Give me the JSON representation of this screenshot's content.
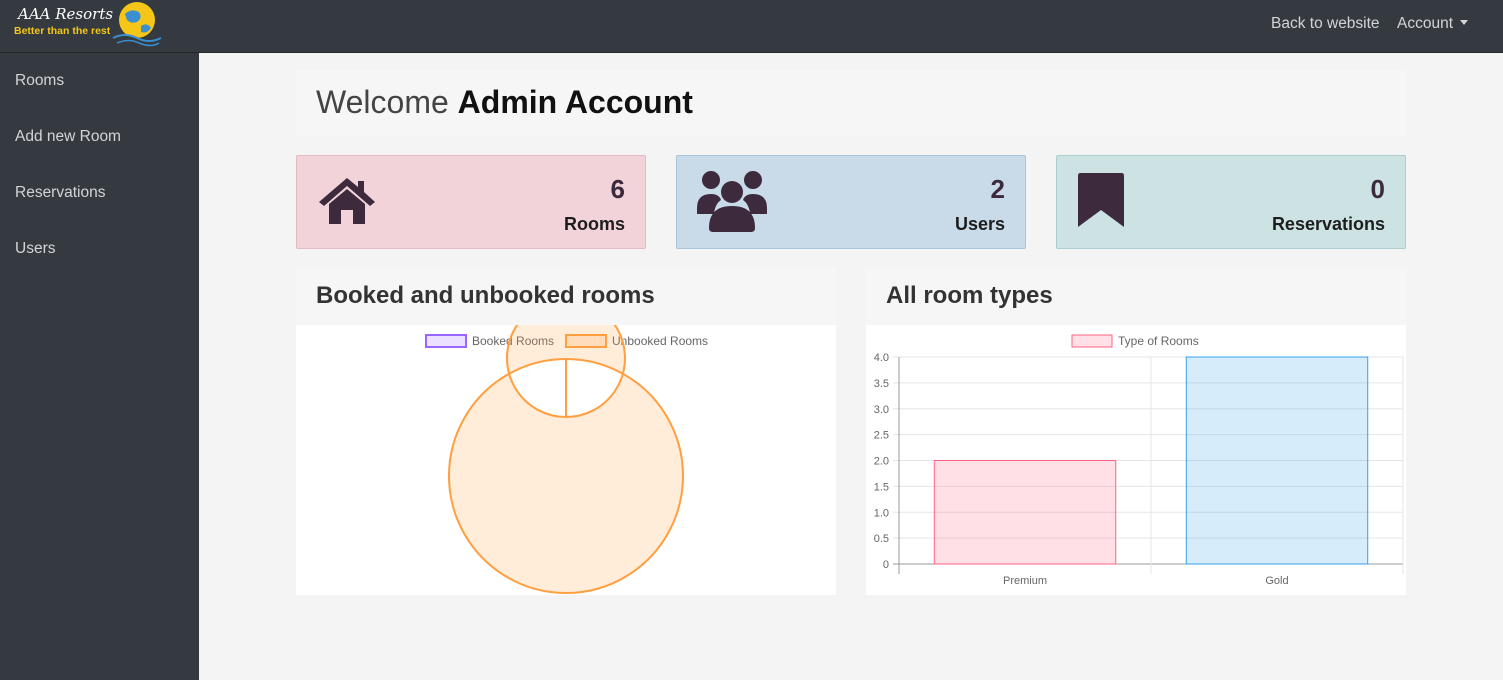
{
  "brand": {
    "name": "AAA Resorts",
    "tagline": "Better than the rest"
  },
  "topnav": {
    "back_label": "Back to website",
    "account_label": "Account"
  },
  "sidebar": {
    "items": [
      {
        "label": "Rooms"
      },
      {
        "label": "Add new Room"
      },
      {
        "label": "Reservations"
      },
      {
        "label": "Users"
      }
    ]
  },
  "welcome": {
    "prefix": "Welcome",
    "name": "Admin Account"
  },
  "stats": [
    {
      "value": "6",
      "label": "Rooms",
      "icon": "house-icon",
      "bg": "#f2d3da"
    },
    {
      "value": "2",
      "label": "Users",
      "icon": "users-icon",
      "bg": "#c9dbe9"
    },
    {
      "value": "0",
      "label": "Reservations",
      "icon": "bookmark-icon",
      "bg": "#cde2e2"
    }
  ],
  "colors": {
    "icon": "#3d2b3d",
    "booked": "#9966ff",
    "unbooked": "#ff9f40",
    "premium": "#ff6384",
    "gold": "#36a2eb"
  },
  "panels": {
    "booked_title": "Booked and unbooked rooms",
    "types_title": "All room types"
  },
  "chart_data": [
    {
      "type": "pie",
      "title": "Booked and unbooked rooms",
      "labels": [
        "Booked Rooms",
        "Unbooked Rooms"
      ],
      "values": [
        0,
        6
      ],
      "legend": "top"
    },
    {
      "type": "bar",
      "title": "All room types",
      "categories": [
        "Premium",
        "Gold"
      ],
      "series": [
        {
          "name": "Type of Rooms",
          "values": [
            2,
            4
          ]
        }
      ],
      "ylim": [
        0,
        4
      ],
      "yticks": [
        "4.0",
        "3.5",
        "3.0",
        "2.5",
        "2.0",
        "1.5",
        "1.0",
        "0.5",
        "0"
      ],
      "grid": true,
      "legend": "top"
    }
  ]
}
